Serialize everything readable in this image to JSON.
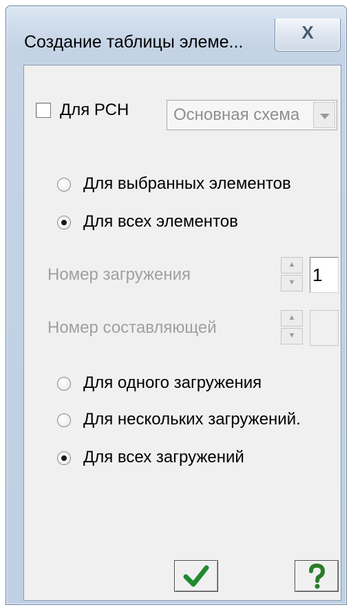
{
  "window": {
    "title": "Создание таблицы элеме...",
    "close_glyph": "X"
  },
  "rsn_checkbox": {
    "label": "Для РСН",
    "checked": false
  },
  "scheme_select": {
    "value": "Основная схема",
    "enabled": false
  },
  "elements_group": [
    {
      "label": "Для выбранных элементов",
      "selected": false
    },
    {
      "label": "Для всех элементов",
      "selected": true
    }
  ],
  "load_number": {
    "label": "Номер загружения",
    "value": "1"
  },
  "component_number": {
    "label": "Номер составляющей",
    "value": ""
  },
  "loads_group": [
    {
      "label": "Для одного загружения",
      "selected": false
    },
    {
      "label": "Для нескольких загружений.",
      "selected": false
    },
    {
      "label": "Для всех загружений",
      "selected": true
    }
  ],
  "buttons": {
    "ok_icon": "checkmark-icon",
    "help_icon": "question-icon",
    "ok_color": "#1f8a2e",
    "help_color": "#2a7d2a"
  }
}
